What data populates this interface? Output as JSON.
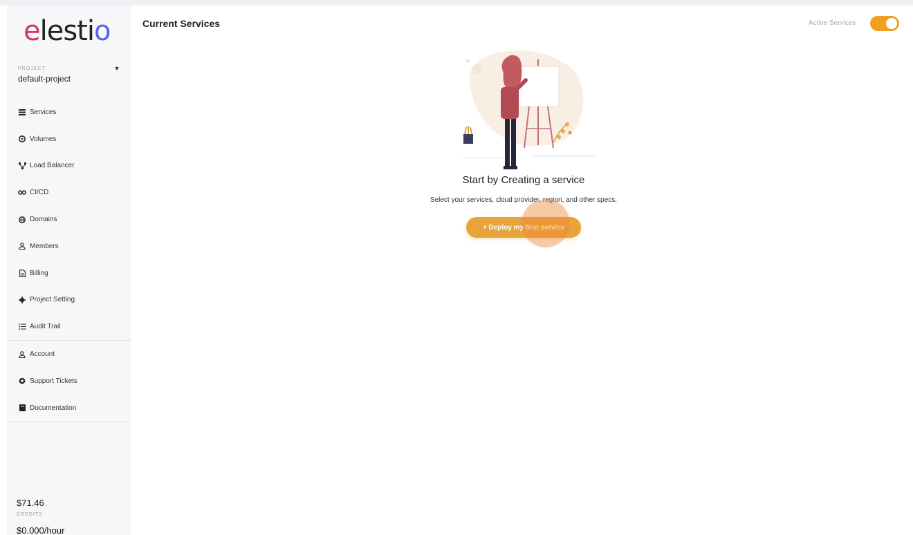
{
  "app": {
    "logo_text": "elestio",
    "colors": {
      "accent": "#e8a33a",
      "toggle": "#f0a020",
      "logo_o": "#5a63e6"
    }
  },
  "sidebar": {
    "project_label": "PROJECT:",
    "project_name": "default-project",
    "items": [
      {
        "label": "Services",
        "icon": "list-icon"
      },
      {
        "label": "Volumes",
        "icon": "volume-icon"
      },
      {
        "label": "Load Balancer",
        "icon": "network-icon"
      },
      {
        "label": "CI/CD",
        "icon": "infinity-icon"
      },
      {
        "label": "Domains",
        "icon": "globe-icon"
      },
      {
        "label": "Members",
        "icon": "user-icon"
      },
      {
        "label": "Billing",
        "icon": "document-icon"
      },
      {
        "label": "Project Setting",
        "icon": "gear-icon"
      },
      {
        "label": "Audit Trail",
        "icon": "list-bullets-icon"
      }
    ],
    "secondary_items": [
      {
        "label": "Account",
        "icon": "user-icon"
      },
      {
        "label": "Support Tickets",
        "icon": "support-icon"
      },
      {
        "label": "Documentation",
        "icon": "book-icon"
      }
    ],
    "credits_amount": "$71.46",
    "credits_label": "CREDITS",
    "rate": "$0.000/hour"
  },
  "main": {
    "title": "Current Services",
    "toggle_label": "Active Services",
    "toggle_on": true,
    "empty_state": {
      "title": "Start by Creating a service",
      "subtitle": "Select your services, cloud provider, region, and other specs.",
      "button_label": "+ Deploy my first service"
    }
  }
}
